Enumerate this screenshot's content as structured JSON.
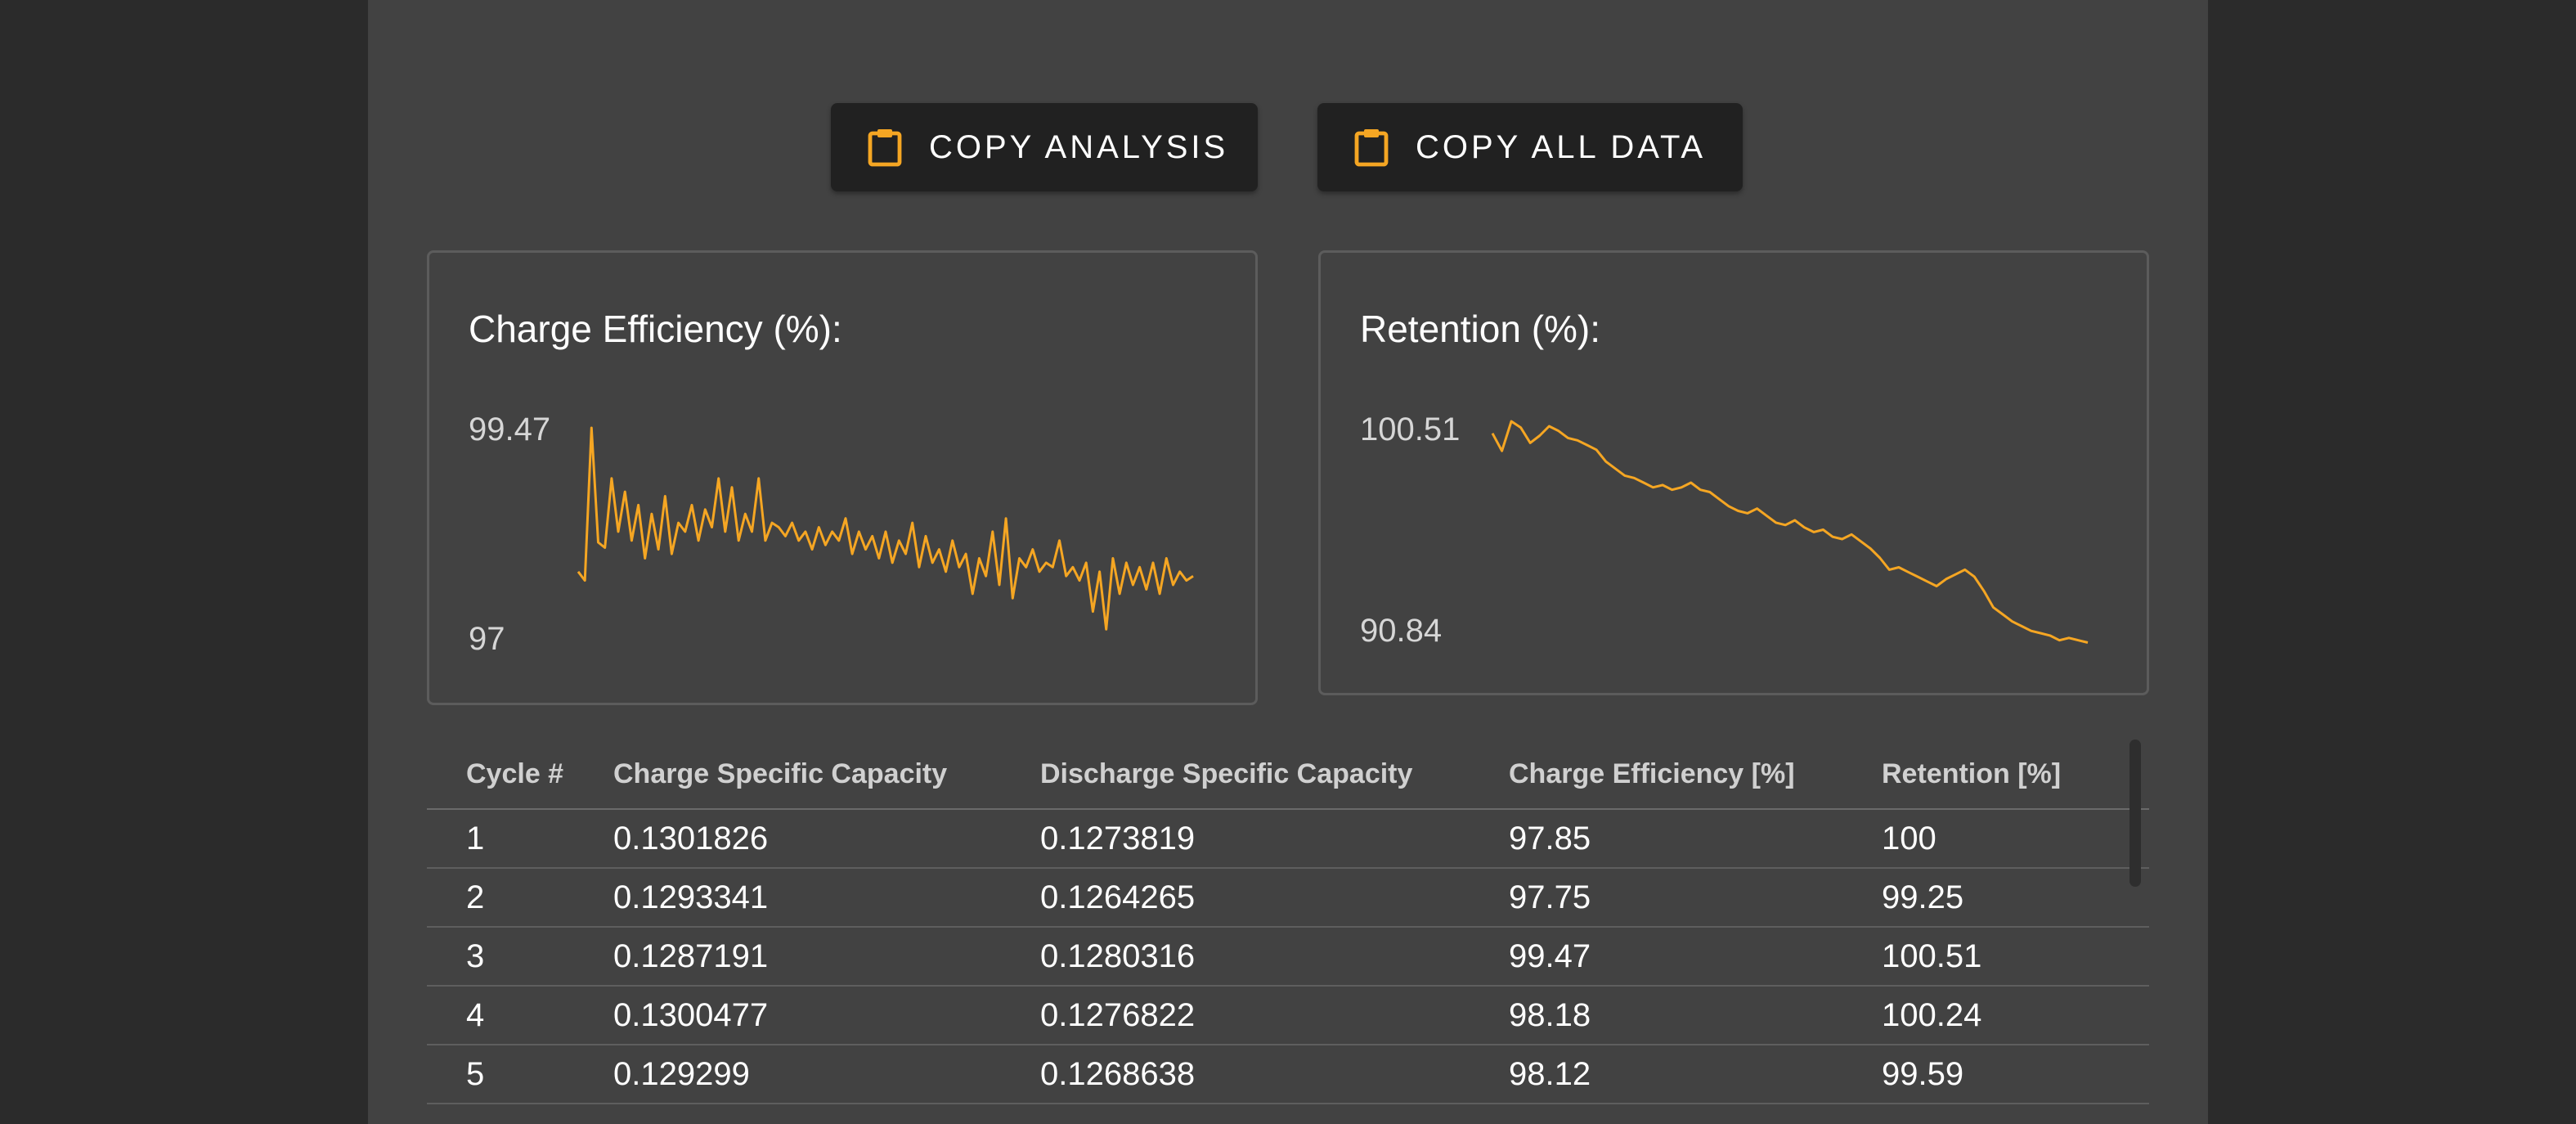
{
  "toolbar": {
    "copy_analysis_label": "COPY ANALYSIS",
    "copy_all_label": "COPY ALL DATA",
    "icon": "clipboard-icon",
    "accent_color": "#f5a623"
  },
  "charts": {
    "efficiency": {
      "title": "Charge Efficiency (%):",
      "max_label": "99.47",
      "min_label": "97"
    },
    "retention": {
      "title": "Retention (%):",
      "max_label": "100.51",
      "min_label": "90.84"
    }
  },
  "chart_data": [
    {
      "type": "line",
      "title": "Charge Efficiency (%):",
      "ylim": [
        97,
        99.47
      ],
      "line_color": "#f5a623",
      "series": [
        {
          "values": [
            97.85,
            97.75,
            99.47,
            98.18,
            98.12,
            98.9,
            98.3,
            98.75,
            98.2,
            98.6,
            98.0,
            98.5,
            98.1,
            98.7,
            98.05,
            98.4,
            98.3,
            98.6,
            98.2,
            98.55,
            98.35,
            98.9,
            98.3,
            98.8,
            98.2,
            98.5,
            98.3,
            98.9,
            98.2,
            98.4,
            98.35,
            98.25,
            98.4,
            98.2,
            98.3,
            98.1,
            98.35,
            98.15,
            98.3,
            98.2,
            98.45,
            98.05,
            98.3,
            98.1,
            98.25,
            98.0,
            98.3,
            97.95,
            98.2,
            98.05,
            98.4,
            97.9,
            98.25,
            97.95,
            98.1,
            97.85,
            98.2,
            97.9,
            98.05,
            97.6,
            98.0,
            97.8,
            98.3,
            97.7,
            98.45,
            97.55,
            98.0,
            97.9,
            98.1,
            97.85,
            97.95,
            97.9,
            98.2,
            97.8,
            97.9,
            97.75,
            97.95,
            97.4,
            97.85,
            97.2,
            98.0,
            97.6,
            97.95,
            97.7,
            97.9,
            97.65,
            97.95,
            97.6,
            98.0,
            97.7,
            97.85,
            97.75,
            97.8
          ]
        }
      ]
    },
    {
      "type": "line",
      "title": "Retention (%):",
      "ylim": [
        90.84,
        100.51
      ],
      "line_color": "#f5a623",
      "series": [
        {
          "values": [
            100,
            99.25,
            100.51,
            100.24,
            99.59,
            99.9,
            100.3,
            100.1,
            99.8,
            99.7,
            99.5,
            99.3,
            98.8,
            98.5,
            98.2,
            98.1,
            97.9,
            97.7,
            97.8,
            97.6,
            97.7,
            97.9,
            97.6,
            97.5,
            97.2,
            96.9,
            96.7,
            96.6,
            96.8,
            96.5,
            96.2,
            96.1,
            96.3,
            96.0,
            95.8,
            95.9,
            95.6,
            95.5,
            95.7,
            95.4,
            95.1,
            94.7,
            94.2,
            94.3,
            94.1,
            93.9,
            93.7,
            93.5,
            93.8,
            94.0,
            94.2,
            93.9,
            93.3,
            92.6,
            92.3,
            92.0,
            91.8,
            91.6,
            91.5,
            91.4,
            91.2,
            91.3,
            91.2,
            91.1
          ]
        }
      ]
    }
  ],
  "table": {
    "columns": [
      "Cycle #",
      "Charge Specific Capacity",
      "Discharge Specific Capacity",
      "Charge Efficiency [%]",
      "Retention [%]"
    ],
    "rows": [
      [
        "1",
        "0.1301826",
        "0.1273819",
        "97.85",
        "100"
      ],
      [
        "2",
        "0.1293341",
        "0.1264265",
        "97.75",
        "99.25"
      ],
      [
        "3",
        "0.1287191",
        "0.1280316",
        "99.47",
        "100.51"
      ],
      [
        "4",
        "0.1300477",
        "0.1276822",
        "98.18",
        "100.24"
      ],
      [
        "5",
        "0.129299",
        "0.1268638",
        "98.12",
        "99.59"
      ]
    ]
  }
}
